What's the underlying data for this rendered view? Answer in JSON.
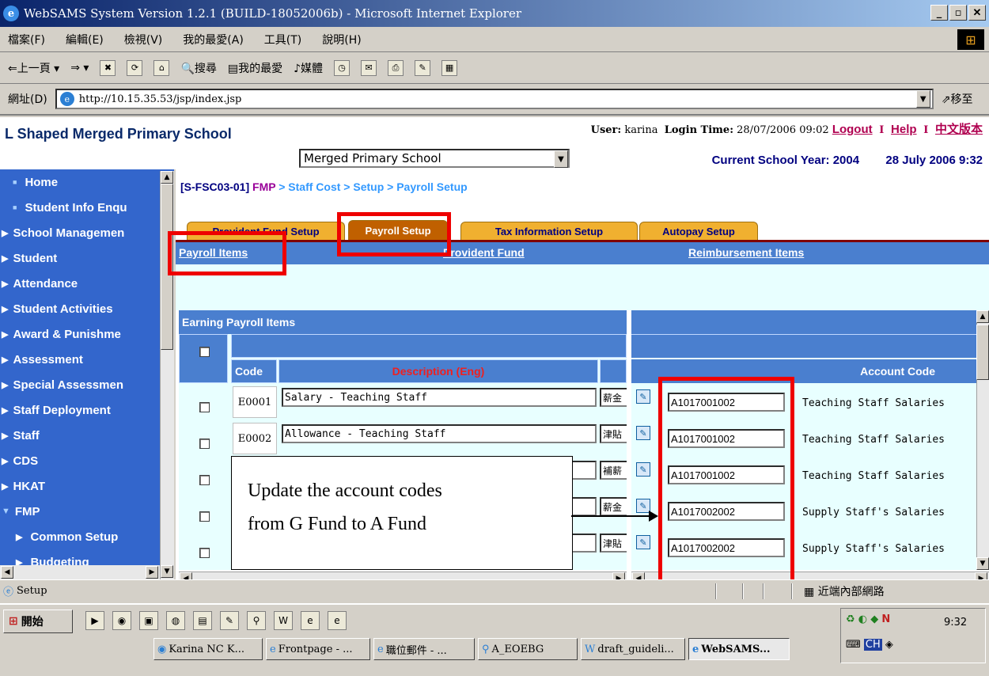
{
  "window": {
    "title": "WebSAMS System Version 1.2.1 (BUILD-18052006b) - Microsoft Internet Explorer"
  },
  "menu": [
    "檔案(F)",
    "編輯(E)",
    "檢視(V)",
    "我的最愛(A)",
    "工具(T)",
    "說明(H)"
  ],
  "toolbar": {
    "back": "上一頁",
    "search": "搜尋",
    "favorites": "我的最愛",
    "media": "媒體"
  },
  "address": {
    "label": "網址(D)",
    "url": "http://10.15.35.53/jsp/index.jsp",
    "go": "移至"
  },
  "header": {
    "school_name": "L Shaped Merged Primary School",
    "user_label": "User:",
    "user": "karina",
    "login_label": "Login Time:",
    "login_time": "28/07/2006 09:02",
    "logout": "Logout",
    "help": "Help",
    "chinese": "中文版本",
    "school_select": "Merged Primary School",
    "current_year": "Current School Year: 2004",
    "date_time": "28 July 2006 9:32"
  },
  "sidebar": {
    "items": [
      {
        "label": "Home",
        "kind": "sub"
      },
      {
        "label": "Student Info Enqu",
        "kind": "sub"
      },
      {
        "label": "School Managemen",
        "kind": "top"
      },
      {
        "label": "Student",
        "kind": "top"
      },
      {
        "label": "Attendance",
        "kind": "top"
      },
      {
        "label": "Student Activities",
        "kind": "top"
      },
      {
        "label": "Award & Punishme",
        "kind": "top"
      },
      {
        "label": "Assessment",
        "kind": "top"
      },
      {
        "label": "Special Assessmen",
        "kind": "top"
      },
      {
        "label": "Staff Deployment",
        "kind": "top"
      },
      {
        "label": "Staff",
        "kind": "top"
      },
      {
        "label": "CDS",
        "kind": "top"
      },
      {
        "label": "HKAT",
        "kind": "top"
      },
      {
        "label": "FMP",
        "kind": "open"
      },
      {
        "label": "Common Setup",
        "kind": "sub2"
      },
      {
        "label": "Budgeting",
        "kind": "sub2"
      }
    ]
  },
  "breadcrumb": {
    "code": "[S-FSC03-01]",
    "fmp": "FMP",
    "path": "> Staff Cost > Setup > Payroll Setup"
  },
  "tabs": [
    "Provident Fund Setup",
    "Payroll Setup",
    "Tax Information Setup",
    "Autopay Setup"
  ],
  "subtabs": [
    "Payroll Items",
    "Provident Fund",
    "Reimbursement Items"
  ],
  "grid": {
    "title": "Earning Payroll Items",
    "col_code": "Code",
    "col_desc": "Description (Eng)",
    "col_account": "Account Code",
    "rows": [
      {
        "code": "E0001",
        "desc": "Salary - Teaching Staff",
        "cn": "薪金",
        "account": "A1017001002",
        "account_desc": "Teaching Staff Salaries"
      },
      {
        "code": "E0002",
        "desc": "Allowance - Teaching Staff",
        "cn": "津貼",
        "account": "A1017001002",
        "account_desc": "Teaching Staff Salaries"
      },
      {
        "code": "",
        "desc": "",
        "cn": "補薪",
        "account": "A1017001002",
        "account_desc": "Teaching Staff Salaries"
      },
      {
        "code": "",
        "desc": "",
        "cn": "薪金",
        "account": "A1017002002",
        "account_desc": "Supply Staff's Salaries"
      },
      {
        "code": "",
        "desc": "",
        "cn": "津貼",
        "account": "A1017002002",
        "account_desc": "Supply Staff's Salaries"
      }
    ]
  },
  "annotation": {
    "line1": "Update the account codes",
    "line2": "from G Fund to A Fund"
  },
  "status": {
    "text": "Setup",
    "zone": "近端內部網路"
  },
  "taskbar": {
    "start": "開始",
    "tasks": [
      "Karina NC K...",
      "Frontpage - ...",
      "職位郵件 - ...",
      "A_EOEBG",
      "draft_guideli...",
      "WebSAMS..."
    ],
    "clock": "9:32",
    "ime": "CH"
  },
  "colors": {
    "nav_blue": "#3366cc",
    "header_blue": "#4a7fcf",
    "tab_orange": "#f0b030",
    "highlight_red": "#ee0000"
  }
}
